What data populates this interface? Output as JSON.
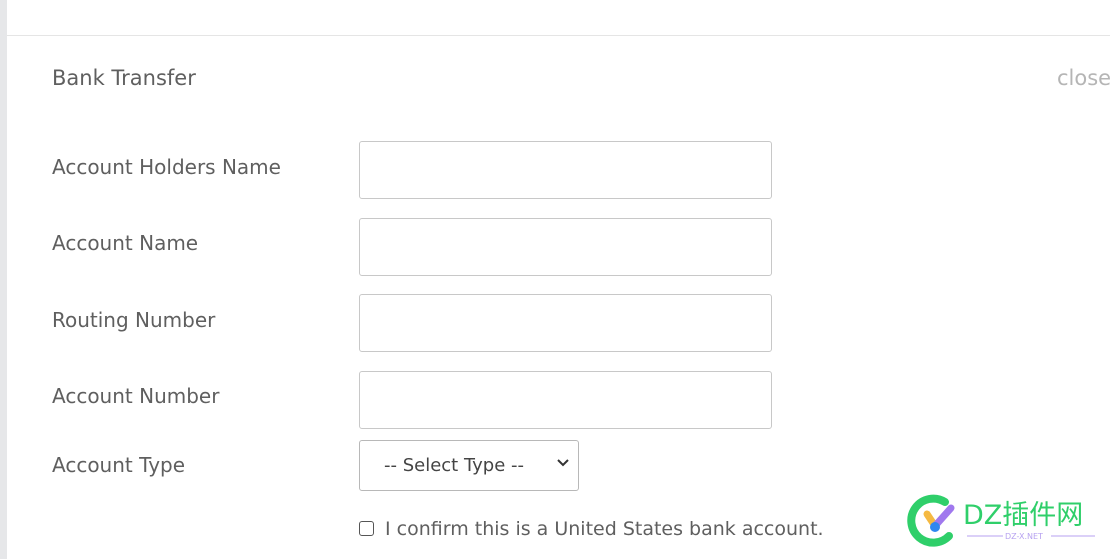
{
  "modal": {
    "title": "Bank Transfer",
    "close_label": "close"
  },
  "fields": [
    {
      "label": "Account Holders Name",
      "value": ""
    },
    {
      "label": "Account Name",
      "value": ""
    },
    {
      "label": "Routing Number",
      "value": ""
    },
    {
      "label": "Account Number",
      "value": ""
    }
  ],
  "account_type": {
    "label": "Account Type",
    "selected": "-- Select Type --"
  },
  "confirm": {
    "label": "I confirm this is a United States bank account.",
    "checked": false
  },
  "watermark": {
    "text": "DZ插件网",
    "sub": "DZ-X.NET"
  }
}
